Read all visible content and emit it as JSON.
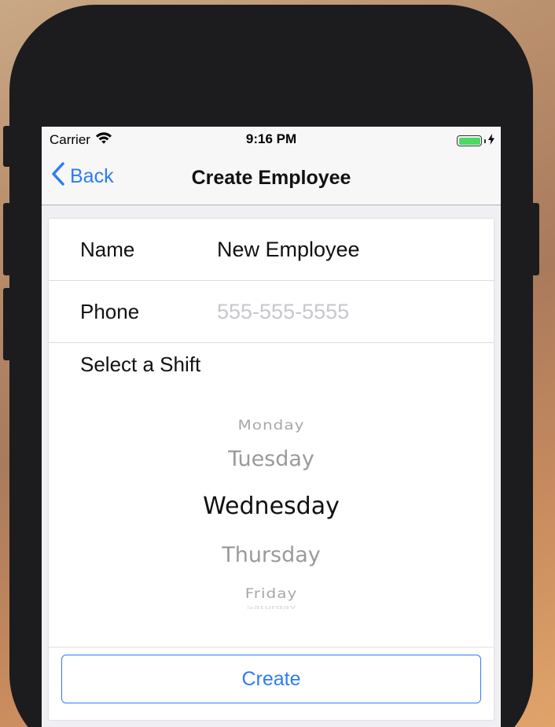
{
  "status_bar": {
    "carrier": "Carrier",
    "time": "9:16 PM",
    "battery_color": "#4cd964"
  },
  "nav": {
    "back_label": "Back",
    "title": "Create Employee",
    "accent_color": "#2d7cf6"
  },
  "form": {
    "name_label": "Name",
    "name_value": "New Employee",
    "phone_label": "Phone",
    "phone_placeholder": "555-555-5555",
    "phone_value": "",
    "shift_label": "Select a Shift"
  },
  "picker": {
    "options": [
      "Monday",
      "Tuesday",
      "Wednesday",
      "Thursday",
      "Friday",
      "Saturday"
    ],
    "selected": "Wednesday"
  },
  "create_label": "Create",
  "icons": {
    "wifi": "wifi-icon",
    "battery": "battery-icon",
    "charging": "charging-icon",
    "back": "chevron-left-icon"
  }
}
